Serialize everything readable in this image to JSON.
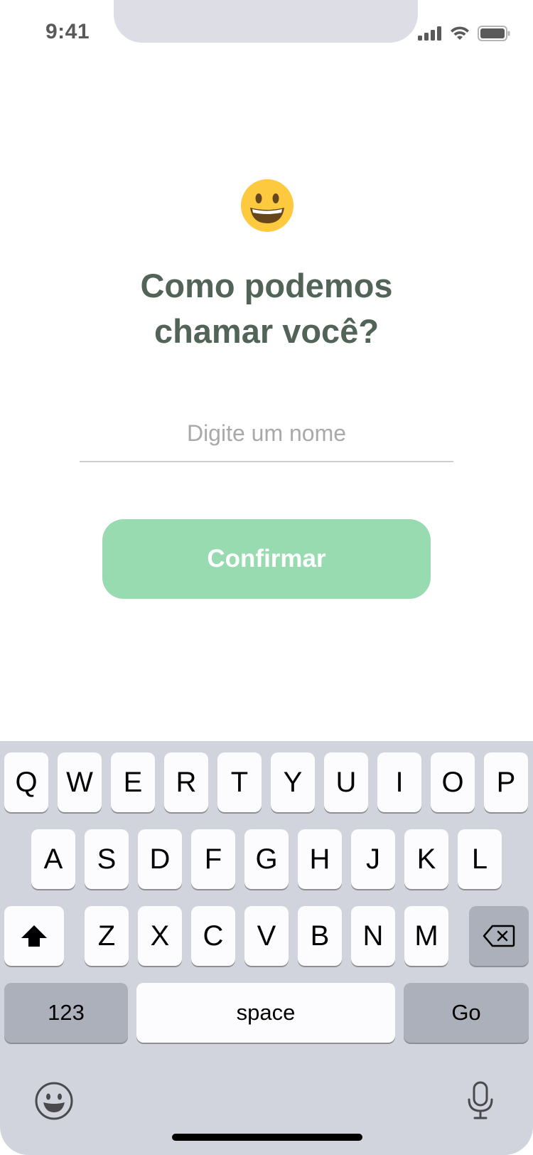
{
  "status_bar": {
    "time": "9:41",
    "icons": [
      "cellular-signal-icon",
      "wifi-icon",
      "battery-icon"
    ]
  },
  "content": {
    "emoji_icon": "grinning-face-emoji",
    "title_line1": "Como podemos",
    "title_line2": "chamar você?",
    "name_input": {
      "value": "",
      "placeholder": "Digite um nome"
    },
    "confirm_label": "Confirmar"
  },
  "keyboard": {
    "row1": [
      "Q",
      "W",
      "E",
      "R",
      "T",
      "Y",
      "U",
      "I",
      "O",
      "P"
    ],
    "row2": [
      "A",
      "S",
      "D",
      "F",
      "G",
      "H",
      "J",
      "K",
      "L"
    ],
    "row3": [
      "Z",
      "X",
      "C",
      "V",
      "B",
      "N",
      "M"
    ],
    "numbers_label": "123",
    "space_label": "space",
    "go_label": "Go",
    "shift_icon": "shift-icon",
    "delete_icon": "backspace-icon",
    "emoji_icon": "emoji-keyboard-icon",
    "mic_icon": "microphone-icon"
  },
  "colors": {
    "title": "#516457",
    "button": "#98dbb0",
    "keyboard_bg": "#d1d4dc",
    "key_light": "#fcfcfe",
    "key_dark": "#abb0ba"
  }
}
